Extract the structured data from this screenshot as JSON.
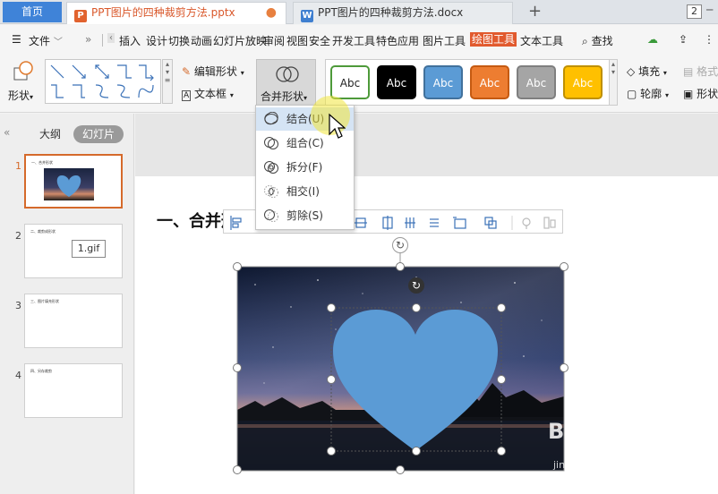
{
  "tabs": {
    "home": "首页",
    "doc1": "PPT图片的四种裁剪方法.pptx",
    "doc2": "PPT图片的四种裁剪方法.docx",
    "doc1_badge": "P",
    "doc2_badge": "W",
    "count": "2"
  },
  "menu": {
    "file": "文件",
    "items": [
      "插入",
      "设计",
      "切换",
      "动画",
      "幻灯片放映",
      "审阅",
      "视图",
      "安全",
      "开发工具",
      "特色应用",
      "图片工具",
      "绘图工具",
      "文本工具"
    ],
    "search": "查找"
  },
  "ribbon": {
    "shape": "形状",
    "edit_shape": "编辑形状",
    "textbox": "文本框",
    "merge_shape": "合并形状",
    "style_sample": "Abc",
    "fill": "填充",
    "format": "格式",
    "outline": "轮廓",
    "shape_effect": "形状"
  },
  "styles": [
    {
      "fill": "#ffffff",
      "border": "#4e9a3a",
      "text": "#222222"
    },
    {
      "fill": "#000000",
      "border": "#000000",
      "text": "#ffffff"
    },
    {
      "fill": "#5b9bd5",
      "border": "#41719c",
      "text": "#ffffff"
    },
    {
      "fill": "#ed7d31",
      "border": "#c55a11",
      "text": "#ffffff"
    },
    {
      "fill": "#a5a5a5",
      "border": "#7f7f7f",
      "text": "#ffffff"
    },
    {
      "fill": "#ffc000",
      "border": "#bf9000",
      "text": "#ffffff"
    }
  ],
  "panel": {
    "outline": "大纲",
    "slides": "幻灯片",
    "thumbs": [
      {
        "num": "1",
        "title": "一、合并形状"
      },
      {
        "num": "2",
        "title": "二、裁剪成形状",
        "gif": "1.gif"
      },
      {
        "num": "3",
        "title": "三、图片填充形状"
      },
      {
        "num": "4",
        "title": "四、另存裁剪"
      }
    ]
  },
  "slide": {
    "title": "一、合并形状"
  },
  "dropdown": {
    "items": [
      "结合(U)",
      "组合(C)",
      "拆分(F)",
      "相交(I)",
      "剪除(S)"
    ]
  },
  "watermark": {
    "main": "Baidu经验",
    "sub": "jingyan.baidu.com"
  },
  "colors": {
    "accent": "#e15a2e",
    "home_tab": "#3f83d8",
    "heart": "#5b9bd5"
  }
}
